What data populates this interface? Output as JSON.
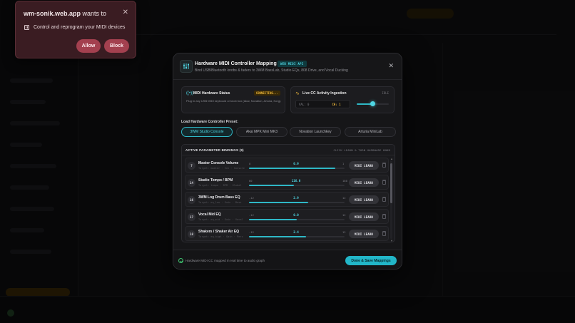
{
  "permission": {
    "site": "wm-sonik.web.app",
    "wants_to": "wants to",
    "request": "Control and reprogram your MIDI devices",
    "allow_label": "Allow",
    "block_label": "Block"
  },
  "modal": {
    "title": "Hardware MIDI Controller Mapping",
    "badge": "WEB MIDI API",
    "subtitle": "Bind USB/Bluetooth knobs & faders to 3WM BassLab, Studio EQs, 808 Drive, and Vocal Ducking",
    "hardware_card": {
      "title": "MIDI Hardware Status",
      "status": "CONNECTING...",
      "description": "Plug in any USB MIDI keyboard or knob box (Akai, Novation, Arturia, Korg)."
    },
    "cc_card": {
      "title": "Live CC Activity Ingestion",
      "state": "IDLE",
      "val_text": "VAL: 0",
      "ch_text": "CH: 1",
      "level": 0.5
    },
    "preset_label": "Load Hardware Controller Preset:",
    "presets": [
      {
        "label": "3WM Studio Console",
        "active": true
      },
      {
        "label": "Akai MPK Mini MK3",
        "active": false
      },
      {
        "label": "Novation Launchkey",
        "active": false
      },
      {
        "label": "Arturia MiniLab",
        "active": false
      }
    ],
    "bindings_title": "ACTIVE PARAMETER BINDINGS (9)",
    "bindings_hint": "CLICK LEARN & TURN HARDWARE KNOB",
    "learn_label": "MIDI LEARN",
    "bindings": [
      {
        "cc": "7",
        "name": "Master Console Volume",
        "target": "Target: master · Vol · Console",
        "min": "0",
        "value": "0.9",
        "max": "1",
        "level": 0.9
      },
      {
        "cc": "14",
        "name": "Studio Tempo / BPM",
        "target": "Target: tempo · BPM · Global",
        "min": "60",
        "value": "116.0",
        "max": "180",
        "level": 0.47
      },
      {
        "cc": "16",
        "name": "3WM Log Drum Bass EQ",
        "target": "Target: eq_low · Gain · Bass",
        "min": "-12",
        "value": "2.9",
        "max": "12",
        "level": 0.62
      },
      {
        "cc": "17",
        "name": "Vocal Mid EQ",
        "target": "Target: eq_mid · Gain · Vocal",
        "min": "-12",
        "value": "0.0",
        "max": "12",
        "level": 0.5
      },
      {
        "cc": "18",
        "name": "Shakers / Shaker Air EQ",
        "target": "Target: eq_high · Gain · Perc",
        "min": "-12",
        "value": "2.4",
        "max": "12",
        "level": 0.6
      }
    ],
    "footer_text": "Hardware MIDI CC mapped in real time to audio graph",
    "footer_button": "Done & Save Mappings"
  }
}
